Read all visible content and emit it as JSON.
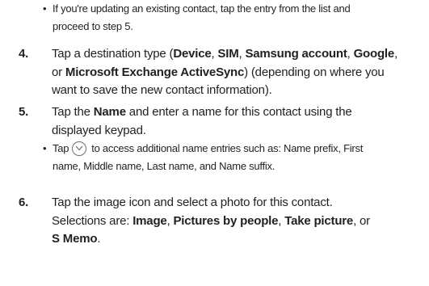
{
  "bullet_top": {
    "line1": "If you're updating an existing contact, tap the entry from the list and",
    "line2": "proceed to step 5."
  },
  "step4": {
    "number": "4.",
    "text1": "Tap a destination type (",
    "device": "Device",
    "sep1": ", ",
    "sim": "SIM",
    "sep2": ", ",
    "samsung": "Samsung account",
    "sep3": ", ",
    "google": "Google",
    "sep4": ",",
    "text2": "or ",
    "exchange": "Microsoft Exchange ActiveSync",
    "text3": ") (depending on where you",
    "text4": "want to save the new contact information)."
  },
  "step5": {
    "number": "5.",
    "text1": "Tap the ",
    "name": "Name",
    "text2": " and enter a name for this contact using the",
    "text3": "displayed keypad.",
    "bullet_tap": "Tap",
    "bullet_text1": "to access additional name entries such as: Name prefix, First",
    "bullet_text2": "name, Middle name, Last name, and Name suffix."
  },
  "step6": {
    "number": "6.",
    "text1": "Tap the image icon and select a photo for this contact.",
    "text2": "Selections are: ",
    "image": "Image",
    "sep1": ", ",
    "pictures": "Pictures by people",
    "sep2": ", ",
    "take": "Take picture",
    "sep3": ", or",
    "smemo": "S Memo",
    "end": "."
  },
  "icons": {
    "bullet": "•",
    "expand": "chevron-down-icon"
  },
  "colors": {
    "text": "#231f20",
    "icon_border": "#6d6e71"
  }
}
